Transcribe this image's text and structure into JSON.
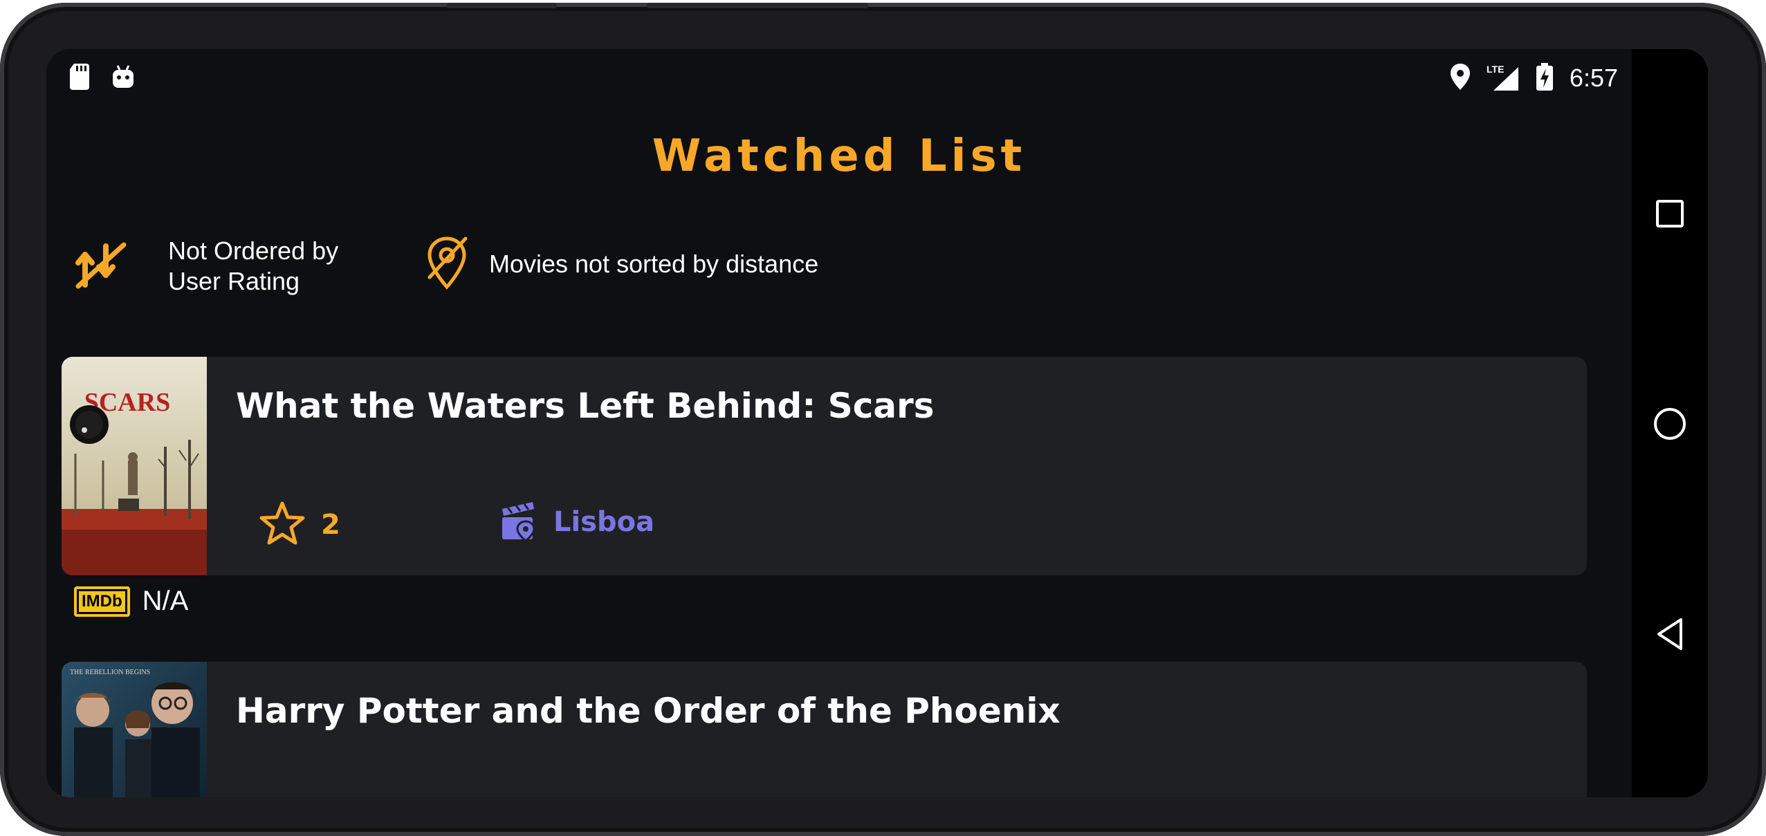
{
  "status_bar": {
    "time": "6:57",
    "network": "LTE",
    "left_icons": [
      "sd-card-icon",
      "android-icon"
    ],
    "right_icons": [
      "location-icon",
      "signal-icon",
      "battery-charging-icon"
    ]
  },
  "header": {
    "title": "Watched List"
  },
  "filters": {
    "rating_label": "Not Ordered by User Rating",
    "distance_label": "Movies not sorted by distance"
  },
  "movies": [
    {
      "title": "What the Waters Left Behind: Scars",
      "user_rating": "2",
      "cinema": "Lisboa",
      "imdb_label": "IMDb",
      "imdb_rating": "N/A"
    },
    {
      "title": "Harry Potter and the Order of the Phoenix"
    }
  ],
  "navigation": [
    "recents-button",
    "home-button",
    "back-button"
  ],
  "colors": {
    "accent": "#f7a829",
    "cinema": "#7b75e3",
    "background": "#0e0f12",
    "card": "#1f2024",
    "imdb": "#f5c518"
  }
}
